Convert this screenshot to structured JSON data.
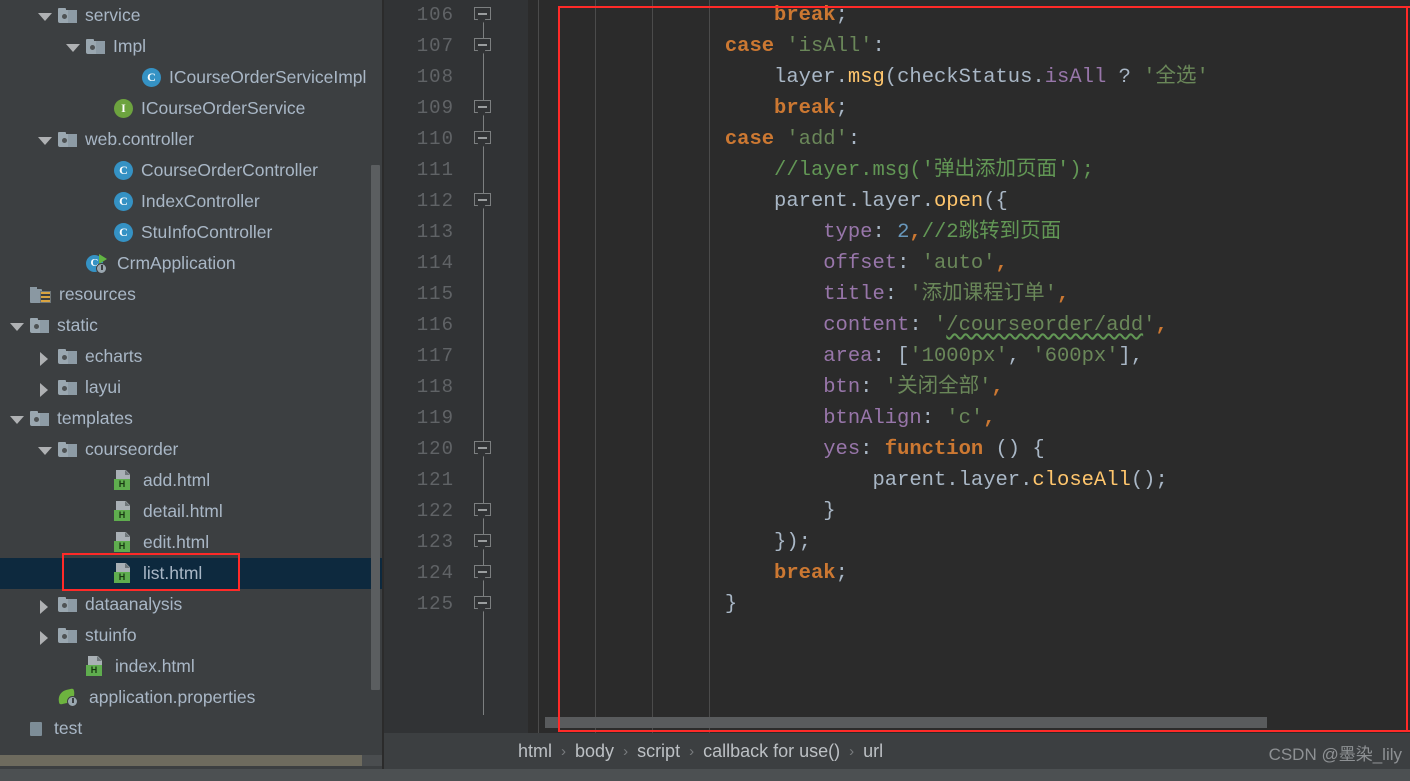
{
  "sidebar": {
    "tree": [
      {
        "indent": 1,
        "arrow": "down",
        "icon": "folder",
        "label": "service"
      },
      {
        "indent": 2,
        "arrow": "down",
        "icon": "folder",
        "label": "Impl"
      },
      {
        "indent": 4,
        "arrow": "none",
        "icon": "class",
        "label": "ICourseOrderServiceImpl"
      },
      {
        "indent": 3,
        "arrow": "none",
        "icon": "interface",
        "label": "ICourseOrderService"
      },
      {
        "indent": 1,
        "arrow": "down",
        "icon": "folder",
        "label": "web.controller"
      },
      {
        "indent": 3,
        "arrow": "none",
        "icon": "class",
        "label": "CourseOrderController"
      },
      {
        "indent": 3,
        "arrow": "none",
        "icon": "class",
        "label": "IndexController"
      },
      {
        "indent": 3,
        "arrow": "none",
        "icon": "class",
        "label": "StuInfoController"
      },
      {
        "indent": 2,
        "arrow": "none",
        "icon": "springapp",
        "label": "CrmApplication"
      },
      {
        "indent": 0,
        "arrow": "none",
        "icon": "resfolder",
        "label": "resources"
      },
      {
        "indent": 0,
        "arrow": "down",
        "icon": "folder",
        "label": "static"
      },
      {
        "indent": 1,
        "arrow": "right",
        "icon": "folder",
        "label": "echarts"
      },
      {
        "indent": 1,
        "arrow": "right",
        "icon": "folder",
        "label": "layui"
      },
      {
        "indent": 0,
        "arrow": "down",
        "icon": "folder",
        "label": "templates"
      },
      {
        "indent": 1,
        "arrow": "down",
        "icon": "folder",
        "label": "courseorder"
      },
      {
        "indent": 3,
        "arrow": "none",
        "icon": "html",
        "label": "add.html"
      },
      {
        "indent": 3,
        "arrow": "none",
        "icon": "html",
        "label": "detail.html"
      },
      {
        "indent": 3,
        "arrow": "none",
        "icon": "html",
        "label": "edit.html"
      },
      {
        "indent": 3,
        "arrow": "none",
        "icon": "html",
        "label": "list.html",
        "selected": true,
        "highlight": true
      },
      {
        "indent": 1,
        "arrow": "right",
        "icon": "folder",
        "label": "dataanalysis"
      },
      {
        "indent": 1,
        "arrow": "right",
        "icon": "folder",
        "label": "stuinfo"
      },
      {
        "indent": 2,
        "arrow": "none",
        "icon": "html",
        "label": "index.html"
      },
      {
        "indent": 1,
        "arrow": "none",
        "icon": "props",
        "label": "application.properties"
      },
      {
        "indent": 0,
        "arrow": "none",
        "icon": "module",
        "label": "test"
      }
    ],
    "html_badge_letter": "H",
    "class_badge_letter": "C",
    "interface_badge_letter": "I",
    "springapp_badge_letter": "C"
  },
  "editor": {
    "line_numbers": [
      106,
      107,
      108,
      109,
      110,
      111,
      112,
      113,
      114,
      115,
      116,
      117,
      118,
      119,
      120,
      121,
      122,
      123,
      124,
      125
    ],
    "lines": [
      {
        "n": 106,
        "tokens": [
          {
            "t": "                    ",
            "c": "plain"
          },
          {
            "t": "break",
            "c": "kw"
          },
          {
            "t": ";",
            "c": "punc"
          }
        ]
      },
      {
        "n": 107,
        "tokens": [
          {
            "t": "                ",
            "c": "plain"
          },
          {
            "t": "case",
            "c": "kw"
          },
          {
            "t": " ",
            "c": "plain"
          },
          {
            "t": "'isAll'",
            "c": "str"
          },
          {
            "t": ":",
            "c": "punc"
          }
        ]
      },
      {
        "n": 108,
        "tokens": [
          {
            "t": "                    ",
            "c": "plain"
          },
          {
            "t": "layer",
            "c": "plain"
          },
          {
            "t": ".",
            "c": "punc"
          },
          {
            "t": "msg",
            "c": "fn"
          },
          {
            "t": "(",
            "c": "punc"
          },
          {
            "t": "checkStatus",
            "c": "plain"
          },
          {
            "t": ".",
            "c": "punc"
          },
          {
            "t": "isAll",
            "c": "prop"
          },
          {
            "t": " ",
            "c": "plain"
          },
          {
            "t": "?",
            "c": "punc"
          },
          {
            "t": " ",
            "c": "plain"
          },
          {
            "t": "'全选'",
            "c": "str"
          }
        ]
      },
      {
        "n": 109,
        "tokens": [
          {
            "t": "                    ",
            "c": "plain"
          },
          {
            "t": "break",
            "c": "kw"
          },
          {
            "t": ";",
            "c": "punc"
          }
        ]
      },
      {
        "n": 110,
        "tokens": [
          {
            "t": "                ",
            "c": "plain"
          },
          {
            "t": "case",
            "c": "kw"
          },
          {
            "t": " ",
            "c": "plain"
          },
          {
            "t": "'add'",
            "c": "str"
          },
          {
            "t": ":",
            "c": "punc"
          }
        ]
      },
      {
        "n": 111,
        "tokens": [
          {
            "t": "                    ",
            "c": "plain"
          },
          {
            "t": "//layer.msg('弹出添加页面');",
            "c": "com"
          }
        ]
      },
      {
        "n": 112,
        "tokens": [
          {
            "t": "                    ",
            "c": "plain"
          },
          {
            "t": "parent",
            "c": "plain"
          },
          {
            "t": ".",
            "c": "punc"
          },
          {
            "t": "layer",
            "c": "plain"
          },
          {
            "t": ".",
            "c": "punc"
          },
          {
            "t": "open",
            "c": "fn"
          },
          {
            "t": "({",
            "c": "punc"
          }
        ]
      },
      {
        "n": 113,
        "tokens": [
          {
            "t": "                        ",
            "c": "plain"
          },
          {
            "t": "type",
            "c": "prop"
          },
          {
            "t": ": ",
            "c": "punc"
          },
          {
            "t": "2",
            "c": "num"
          },
          {
            "t": ",",
            "c": "kw"
          },
          {
            "t": "//2跳转到页面",
            "c": "com"
          }
        ]
      },
      {
        "n": 114,
        "tokens": [
          {
            "t": "                        ",
            "c": "plain"
          },
          {
            "t": "offset",
            "c": "prop"
          },
          {
            "t": ": ",
            "c": "punc"
          },
          {
            "t": "'auto'",
            "c": "str"
          },
          {
            "t": ",",
            "c": "kw"
          }
        ]
      },
      {
        "n": 115,
        "tokens": [
          {
            "t": "                        ",
            "c": "plain"
          },
          {
            "t": "title",
            "c": "prop"
          },
          {
            "t": ": ",
            "c": "punc"
          },
          {
            "t": "'添加课程订单'",
            "c": "str"
          },
          {
            "t": ",",
            "c": "kw"
          }
        ]
      },
      {
        "n": 116,
        "tokens": [
          {
            "t": "                        ",
            "c": "plain"
          },
          {
            "t": "content",
            "c": "prop"
          },
          {
            "t": ": ",
            "c": "punc"
          },
          {
            "t": "'",
            "c": "str"
          },
          {
            "t": "/courseorder/add",
            "c": "str squig"
          },
          {
            "t": "'",
            "c": "str"
          },
          {
            "t": ",",
            "c": "kw"
          }
        ]
      },
      {
        "n": 117,
        "tokens": [
          {
            "t": "                        ",
            "c": "plain"
          },
          {
            "t": "area",
            "c": "prop"
          },
          {
            "t": ": [",
            "c": "punc"
          },
          {
            "t": "'1000px'",
            "c": "str"
          },
          {
            "t": ", ",
            "c": "punc"
          },
          {
            "t": "'600px'",
            "c": "str"
          },
          {
            "t": "],",
            "c": "punc"
          }
        ]
      },
      {
        "n": 118,
        "tokens": [
          {
            "t": "                        ",
            "c": "plain"
          },
          {
            "t": "btn",
            "c": "prop"
          },
          {
            "t": ": ",
            "c": "punc"
          },
          {
            "t": "'关闭全部'",
            "c": "str"
          },
          {
            "t": ",",
            "c": "kw"
          }
        ]
      },
      {
        "n": 119,
        "tokens": [
          {
            "t": "                        ",
            "c": "plain"
          },
          {
            "t": "btnAlign",
            "c": "prop"
          },
          {
            "t": ": ",
            "c": "punc"
          },
          {
            "t": "'c'",
            "c": "str"
          },
          {
            "t": ",",
            "c": "kw"
          }
        ]
      },
      {
        "n": 120,
        "tokens": [
          {
            "t": "                        ",
            "c": "plain"
          },
          {
            "t": "yes",
            "c": "prop"
          },
          {
            "t": ": ",
            "c": "punc"
          },
          {
            "t": "function",
            "c": "kw"
          },
          {
            "t": " () {",
            "c": "punc"
          }
        ]
      },
      {
        "n": 121,
        "tokens": [
          {
            "t": "                            ",
            "c": "plain"
          },
          {
            "t": "parent",
            "c": "plain"
          },
          {
            "t": ".",
            "c": "punc"
          },
          {
            "t": "layer",
            "c": "plain"
          },
          {
            "t": ".",
            "c": "punc"
          },
          {
            "t": "closeAll",
            "c": "fn"
          },
          {
            "t": "();",
            "c": "punc"
          }
        ]
      },
      {
        "n": 122,
        "tokens": [
          {
            "t": "                        ",
            "c": "plain"
          },
          {
            "t": "}",
            "c": "punc"
          }
        ]
      },
      {
        "n": 123,
        "tokens": [
          {
            "t": "                    ",
            "c": "plain"
          },
          {
            "t": "});",
            "c": "punc"
          }
        ]
      },
      {
        "n": 124,
        "tokens": [
          {
            "t": "                    ",
            "c": "plain"
          },
          {
            "t": "break",
            "c": "kw"
          },
          {
            "t": ";",
            "c": "punc"
          }
        ]
      },
      {
        "n": 125,
        "tokens": [
          {
            "t": "                ",
            "c": "plain"
          },
          {
            "t": "}",
            "c": "punc"
          }
        ]
      }
    ],
    "fold_rows": [
      0,
      1,
      3,
      4,
      6,
      14,
      16,
      17,
      18,
      19
    ],
    "colors": {
      "background": "#2B2B2B",
      "gutter": "#313335",
      "keyword": "#CC7832",
      "string": "#6A8759",
      "number": "#6897BB",
      "comment": "#629755",
      "property": "#9876AA",
      "function": "#FFC66D",
      "default_text": "#A9B7C6",
      "line_number": "#606366",
      "annotation_box": "#FF2A28",
      "selection": "#0D293E"
    }
  },
  "breadcrumb": {
    "items": [
      "html",
      "body",
      "script",
      "callback for use()",
      "url"
    ],
    "separator": "›"
  },
  "watermark": {
    "text": "CSDN @墨染_lily"
  }
}
